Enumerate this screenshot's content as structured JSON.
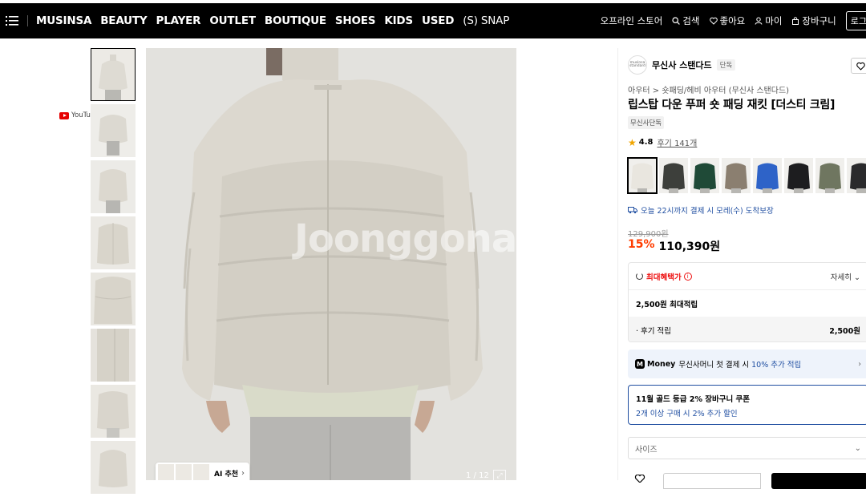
{
  "nav": {
    "items": [
      "MUSINSA",
      "BEAUTY",
      "PLAYER",
      "OUTLET",
      "BOUTIQUE",
      "SHOES",
      "KIDS",
      "USED",
      "(S) SNAP"
    ],
    "right": {
      "offline": "오프라인 스토어",
      "search": "검색",
      "like": "좋아요",
      "my": "마이",
      "cart": "장바구니",
      "login": "로그"
    }
  },
  "youtube": {
    "label": "YouTube"
  },
  "gallery": {
    "watermark": "Joonggonara",
    "ai_label": "AI 추천",
    "counter": "1 / 12"
  },
  "product": {
    "brand": "무신사 스탠다드",
    "brand_logo": "musinsa standard",
    "exclusive": "단독",
    "breadcrumb": "아우터 > 숏패딩/헤비 아우터 (무신사 스탠다드)",
    "title": "립스탑 다운 푸퍼 숏 패딩 재킷 [더스티 크림]",
    "tag": "무신사단독",
    "rating": "4.8",
    "reviews": "후기 141개",
    "delivery": "오늘 22시까지 결제 시 모레(수) 도착보장",
    "original_price": "129,900원",
    "discount": "15%",
    "price": "110,390원",
    "colors": [
      "#e9e6df",
      "#3d3f3b",
      "#1f4a37",
      "#8b7f70",
      "#2e63c8",
      "#1d1d1f",
      "#6f7660",
      "#2a2a2c"
    ]
  },
  "benefit": {
    "label": "최대혜택가",
    "detail": "자세히",
    "max_points": "2,500원 최대적립",
    "review_label": "· 후기 적립",
    "review_amount": "2,500원"
  },
  "money": {
    "badge": "M",
    "word": "Money",
    "text": "무신사머니 첫 결제 시",
    "highlight": "10% 추가 적립"
  },
  "coupon": {
    "title": "11월 골드 등급 2% 장바구니 쿠폰",
    "sub": "2개 이상 구매 시 2% 추가 할인"
  },
  "size": {
    "placeholder": "사이즈"
  }
}
